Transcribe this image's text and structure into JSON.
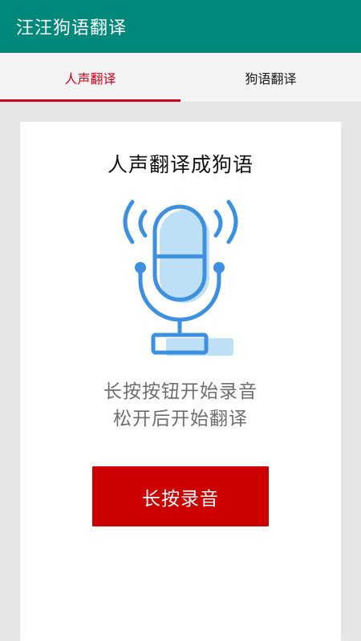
{
  "app_bar": {
    "title": "汪汪狗语翻译"
  },
  "tabs": [
    {
      "label": "人声翻译",
      "active": true
    },
    {
      "label": "狗语翻译",
      "active": false
    }
  ],
  "card": {
    "title": "人声翻译成狗语",
    "instruction_line1": "长按按钮开始录音",
    "instruction_line2": "松开后开始翻译",
    "record_button_label": "长按录音"
  },
  "icons": {
    "microphone": "microphone-icon"
  },
  "colors": {
    "app_bar": "#00897b",
    "accent_red": "#d0021b",
    "button_red": "#cc0000",
    "mic_blue": "#3d8fe0",
    "mic_fill": "#bde0f7"
  }
}
